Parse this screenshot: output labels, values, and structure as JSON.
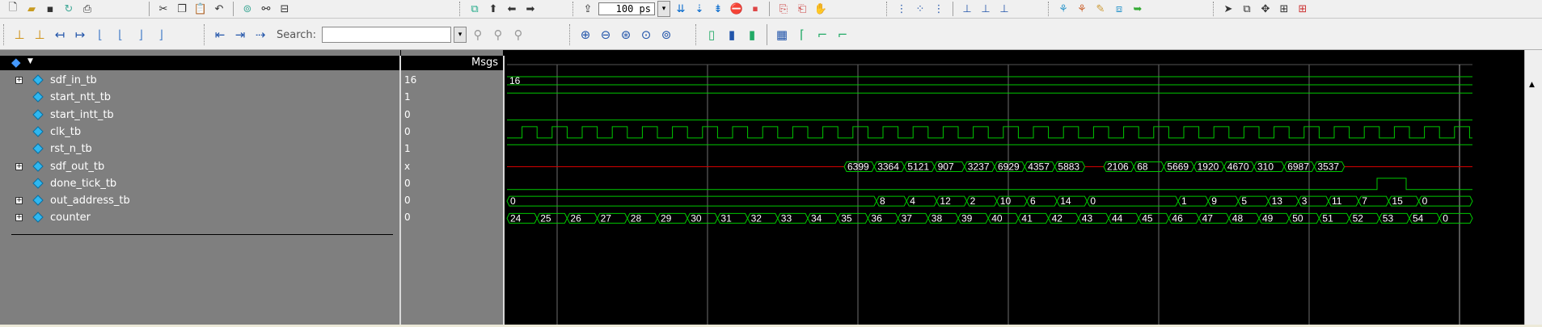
{
  "toolbar1": {
    "groups": [
      {
        "icons": [
          "new-file-icon",
          "open-folder-icon",
          "save-icon",
          "reload-icon",
          "print-icon"
        ]
      },
      {
        "icons": [
          "cut-icon",
          "copy-icon",
          "paste-icon",
          "undo-icon"
        ]
      },
      {
        "icons": [
          "find-icon",
          "binoculars-icon",
          "zoom-region-icon"
        ]
      },
      {
        "icons": [
          "add-wave-icon",
          "up-arrow-icon",
          "step-back-icon",
          "step-forward-icon"
        ]
      },
      {
        "icons": [
          "restart-icon",
          "run-length-icon",
          "run-icon",
          "continue-icon",
          "run-all-icon",
          "break-icon"
        ]
      },
      {
        "icons": [
          "step-into-icon",
          "step-over-icon",
          "step-out-icon",
          "step-icon",
          "step-cont-icon",
          "step-end-icon"
        ]
      },
      {
        "icons": [
          "cursor-add-icon",
          "cursor-lock-icon",
          "edit-icon",
          "wave-compare-icon",
          "wave-export-icon"
        ]
      },
      {
        "icons": [
          "select-pointer-icon",
          "zoom-box-icon",
          "pan-icon",
          "ruler-icon",
          "dataflow-icon"
        ]
      }
    ],
    "sim_time": "100 ps"
  },
  "toolbar2": {
    "search_label": "Search:",
    "search_placeholder": ""
  },
  "wave": {
    "msgs_title": "Msgs",
    "signals": [
      {
        "name": "sdf_in_tb",
        "value": "16",
        "expandable": true,
        "type": "bus"
      },
      {
        "name": "start_ntt_tb",
        "value": "1",
        "expandable": false,
        "type": "bit"
      },
      {
        "name": "start_intt_tb",
        "value": "0",
        "expandable": false,
        "type": "bit"
      },
      {
        "name": "clk_tb",
        "value": "0",
        "expandable": false,
        "type": "clock"
      },
      {
        "name": "rst_n_tb",
        "value": "1",
        "expandable": false,
        "type": "bit"
      },
      {
        "name": "sdf_out_tb",
        "value": "x",
        "expandable": true,
        "type": "bus"
      },
      {
        "name": "done_tick_tb",
        "value": "0",
        "expandable": false,
        "type": "bit"
      },
      {
        "name": "out_address_tb",
        "value": "0",
        "expandable": true,
        "type": "bus"
      },
      {
        "name": "counter",
        "value": "0",
        "expandable": true,
        "type": "bus"
      }
    ],
    "sdf_in_initial": "16",
    "sdf_out_values_1": [
      "6399",
      "3364",
      "5121",
      "907",
      "3237",
      "6929",
      "4357",
      "5883"
    ],
    "sdf_out_values_2": [
      "2106",
      "68",
      "5669",
      "1920",
      "4670",
      "310",
      "6987",
      "3537"
    ],
    "out_address_initial": "0",
    "out_address_values_1": [
      "8",
      "4",
      "12",
      "2",
      "10",
      "6",
      "14",
      "0"
    ],
    "out_address_values_2": [
      "1",
      "9",
      "5",
      "13",
      "3",
      "11",
      "7",
      "15",
      "0"
    ],
    "counter_values": [
      "24",
      "25",
      "26",
      "27",
      "28",
      "29",
      "30",
      "31",
      "32",
      "33",
      "34",
      "35",
      "36",
      "37",
      "38",
      "39",
      "40",
      "41",
      "42",
      "43",
      "44",
      "45",
      "46",
      "47",
      "48",
      "49",
      "50",
      "51",
      "52",
      "53",
      "54",
      "0"
    ]
  },
  "colors": {
    "wave_green": "#00c800",
    "x_red": "#d40000",
    "background_black": "#000000",
    "panel_gray": "#7f7f7f",
    "cursor_gray": "#6e6e6e"
  }
}
